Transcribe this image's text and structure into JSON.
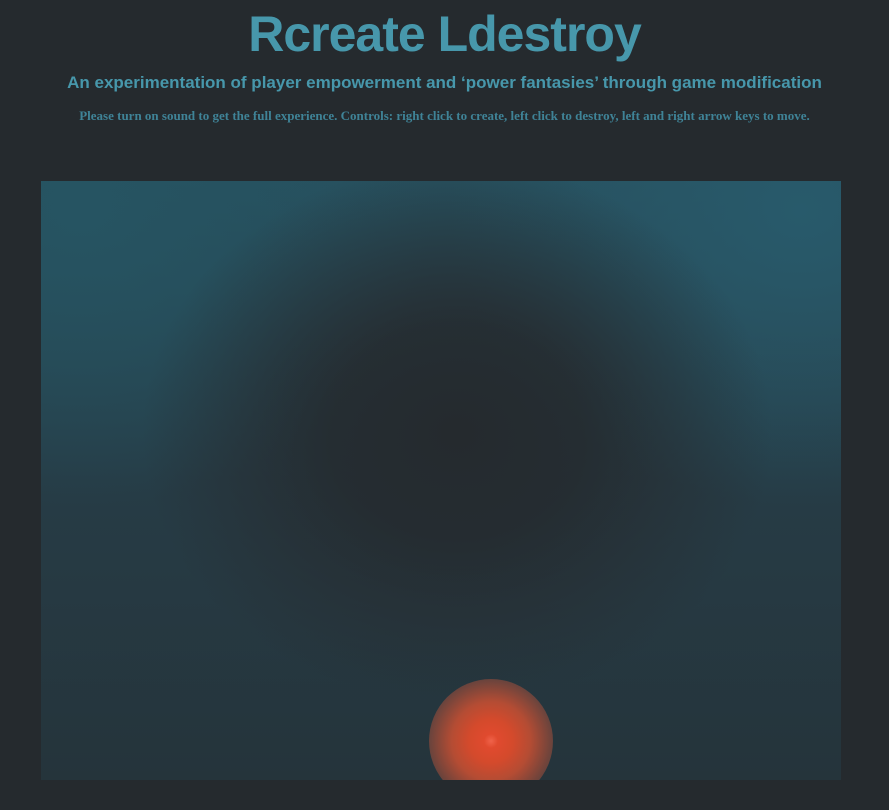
{
  "page": {
    "title": "Rcreate Ldestroy",
    "subtitle": "An experimentation of player empowerment and ‘power fantasies’ through game modification",
    "instructions": "Please turn on sound to get the full experience. Controls: right click to create, left click to destroy, left and right arrow keys to move."
  },
  "game": {
    "player_color": "#e04a2e",
    "background_top_color": "#285a6b",
    "background_center_color": "#252a2e"
  }
}
